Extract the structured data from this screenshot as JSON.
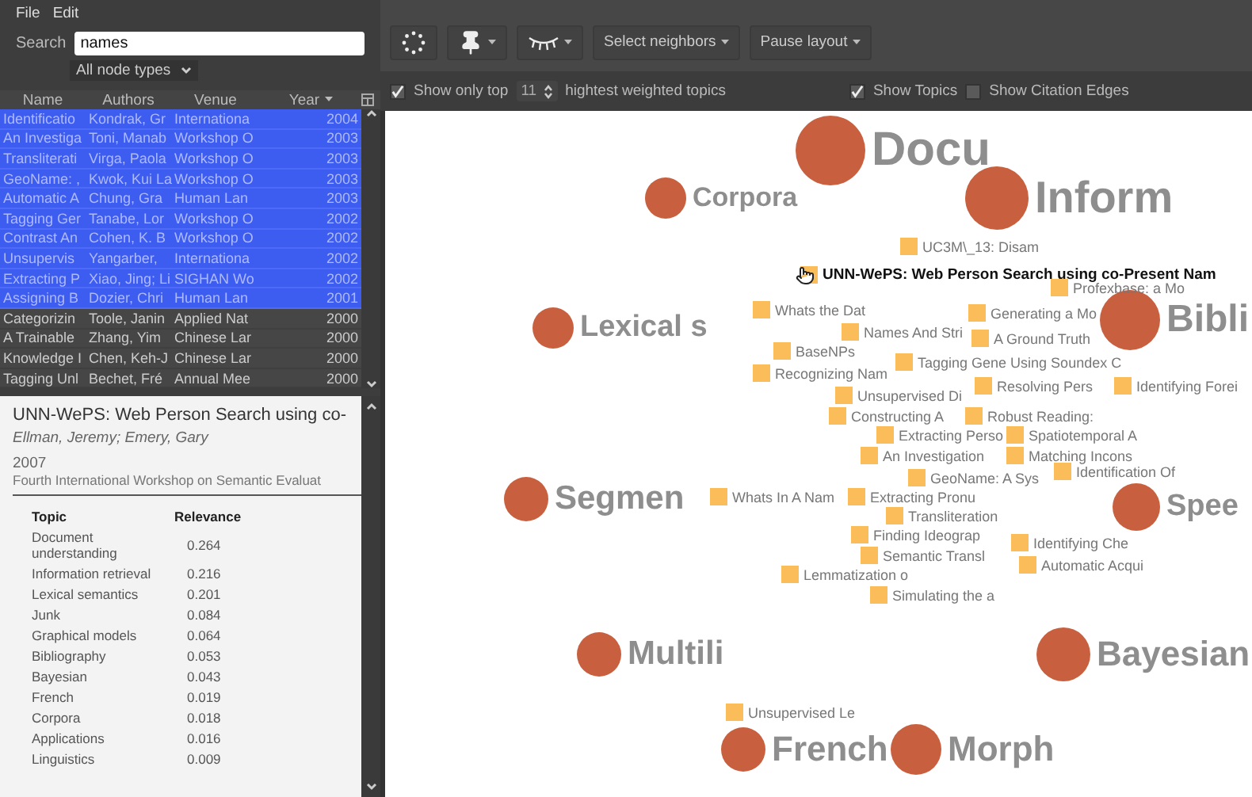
{
  "menu": [
    "File",
    "Edit"
  ],
  "search": {
    "label": "Search",
    "value": "names",
    "filter": "All node types"
  },
  "table": {
    "columns": [
      "Name",
      "Authors",
      "Venue",
      "Year"
    ],
    "rows": [
      {
        "name": "Identificatio",
        "authors": "Kondrak, Gr",
        "venue": "Internationa",
        "year": "2004",
        "selected": true
      },
      {
        "name": "An Investiga",
        "authors": "Toni, Manab",
        "venue": "Workshop O",
        "year": "2003",
        "selected": true
      },
      {
        "name": "Transliterati",
        "authors": "Virga, Paola",
        "venue": "Workshop O",
        "year": "2003",
        "selected": true
      },
      {
        "name": "GeoName: ,",
        "authors": "Kwok, Kui La",
        "venue": "Workshop O",
        "year": "2003",
        "selected": true
      },
      {
        "name": "Automatic A",
        "authors": "Chung, Gra",
        "venue": "Human Lan",
        "year": "2003",
        "selected": true
      },
      {
        "name": "Tagging Ger",
        "authors": "Tanabe, Lor",
        "venue": "Workshop O",
        "year": "2002",
        "selected": true
      },
      {
        "name": "Contrast An",
        "authors": "Cohen, K. B",
        "venue": "Workshop O",
        "year": "2002",
        "selected": true
      },
      {
        "name": "Unsupervis",
        "authors": "Yangarber,",
        "venue": "Internationa",
        "year": "2002",
        "selected": true
      },
      {
        "name": "Extracting P",
        "authors": "Xiao, Jing; Li",
        "venue": "SIGHAN Wo",
        "year": "2002",
        "selected": true
      },
      {
        "name": "Assigning B",
        "authors": "Dozier, Chri",
        "venue": "Human Lan",
        "year": "2001",
        "selected": true
      },
      {
        "name": "Categorizin",
        "authors": "Toole, Janin",
        "venue": "Applied Nat",
        "year": "2000",
        "selected": false
      },
      {
        "name": "A Trainable",
        "authors": "Zhang, Yim",
        "venue": "Chinese Lar",
        "year": "2000",
        "selected": false
      },
      {
        "name": "Knowledge I",
        "authors": "Chen, Keh-J",
        "venue": "Chinese Lar",
        "year": "2000",
        "selected": false
      },
      {
        "name": "Tagging Unl",
        "authors": "Bechet, Fré",
        "venue": "Annual Mee",
        "year": "2000",
        "selected": false
      }
    ]
  },
  "detail": {
    "title": "UNN-WePS: Web Person Search using co-",
    "authors": "Ellman, Jeremy; Emery, Gary",
    "year": "2007",
    "venue": "Fourth International Workshop on Semantic Evaluat",
    "columns": [
      "Topic",
      "Relevance"
    ],
    "topics": [
      {
        "topic": "Document understanding",
        "relevance": "0.264"
      },
      {
        "topic": "Information retrieval",
        "relevance": "0.216"
      },
      {
        "topic": "Lexical semantics",
        "relevance": "0.201"
      },
      {
        "topic": "Junk",
        "relevance": "0.084"
      },
      {
        "topic": "Graphical models",
        "relevance": "0.064"
      },
      {
        "topic": "Bibliography",
        "relevance": "0.053"
      },
      {
        "topic": "Bayesian",
        "relevance": "0.043"
      },
      {
        "topic": "French",
        "relevance": "0.019"
      },
      {
        "topic": "Corpora",
        "relevance": "0.018"
      },
      {
        "topic": "Applications",
        "relevance": "0.016"
      },
      {
        "topic": "Linguistics",
        "relevance": "0.009"
      }
    ]
  },
  "toolbar": {
    "buttons": [
      "Select neighbors",
      "Pause layout"
    ]
  },
  "options": {
    "show_top": {
      "label": "Show only top",
      "checked": true,
      "value": "11",
      "suffix": "hightest weighted topics"
    },
    "show_topics": {
      "label": "Show Topics",
      "checked": true
    },
    "show_citation_edges": {
      "label": "Show Citation Edges",
      "checked": false
    }
  },
  "canvas": {
    "topics": [
      "Docu",
      "Corpora",
      "Inform",
      "Lexical s",
      "Bibli",
      "Segmen",
      "Spee",
      "Multili",
      "Bayesian",
      "French",
      "Morph"
    ],
    "papers": [
      {
        "label": "UC3M\\_13: Disam",
        "selected": false
      },
      {
        "label": "UNN-WePS: Web Person Search using co-Present Nam",
        "selected": true
      },
      {
        "label": "Profexbase: a Mo",
        "selected": false
      },
      {
        "label": "Whats the Dat",
        "selected": false
      },
      {
        "label": "Generating a Mo",
        "selected": false
      },
      {
        "label": "Names And Stri",
        "selected": false
      },
      {
        "label": "A Ground Truth",
        "selected": false
      },
      {
        "label": "BaseNPs",
        "selected": false
      },
      {
        "label": "Tagging Gene Using Soundex C",
        "selected": false
      },
      {
        "label": "Recognizing Nam",
        "selected": false
      },
      {
        "label": "Resolving Pers",
        "selected": false
      },
      {
        "label": "Identifying Forei",
        "selected": false
      },
      {
        "label": "Unsupervised Di",
        "selected": false
      },
      {
        "label": "Constructing A",
        "selected": false
      },
      {
        "label": "Robust Reading:",
        "selected": false
      },
      {
        "label": "Extracting Perso",
        "selected": false
      },
      {
        "label": "Spatiotemporal A",
        "selected": false
      },
      {
        "label": "An Investigation",
        "selected": false
      },
      {
        "label": "Matching Incons",
        "selected": false
      },
      {
        "label": "GeoName: A Sys",
        "selected": false
      },
      {
        "label": "Identification Of",
        "selected": false
      },
      {
        "label": "Whats In A Nam",
        "selected": false
      },
      {
        "label": "Extracting Pronu",
        "selected": false
      },
      {
        "label": "Transliteration",
        "selected": false
      },
      {
        "label": "Identifying Che",
        "selected": false
      },
      {
        "label": "Finding Ideograp",
        "selected": false
      },
      {
        "label": "Automatic Acqui",
        "selected": false
      },
      {
        "label": "Semantic Transl",
        "selected": false
      },
      {
        "label": "Lemmatization o",
        "selected": false
      },
      {
        "label": "Simulating the a",
        "selected": false
      },
      {
        "label": "Unsupervised Le",
        "selected": false
      }
    ]
  }
}
